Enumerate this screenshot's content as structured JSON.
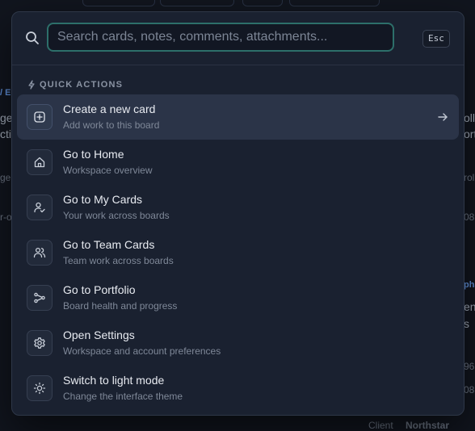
{
  "background": {
    "fragments": [
      "ge",
      "cti",
      "gel",
      "r-o",
      "olli",
      "ort",
      "rol",
      "08",
      "pha",
      "end",
      "s",
      "96",
      "08",
      "Client",
      "Northstar",
      "/ E"
    ]
  },
  "search": {
    "placeholder": "Search cards, notes, comments, attachments...",
    "value": "",
    "esc_label": "Esc",
    "icon": "search-icon"
  },
  "section": {
    "title": "QUICK ACTIONS",
    "icon": "bolt-icon"
  },
  "items": [
    {
      "title": "Create a new card",
      "subtitle": "Add work to this board",
      "icon": "plus-square-icon",
      "selected": true
    },
    {
      "title": "Go to Home",
      "subtitle": "Workspace overview",
      "icon": "home-icon"
    },
    {
      "title": "Go to My Cards",
      "subtitle": "Your work across boards",
      "icon": "user-check-icon"
    },
    {
      "title": "Go to Team Cards",
      "subtitle": "Team work across boards",
      "icon": "users-icon"
    },
    {
      "title": "Go to Portfolio",
      "subtitle": "Board health and progress",
      "icon": "branch-icon"
    },
    {
      "title": "Open Settings",
      "subtitle": "Workspace and account preferences",
      "icon": "gear-icon"
    },
    {
      "title": "Switch to light mode",
      "subtitle": "Change the interface theme",
      "icon": "sun-icon"
    }
  ],
  "colors": {
    "accent": "#2d6f6a",
    "panel": "#1a2130",
    "selected_row": "#2b3448",
    "backdrop": "#11151e"
  }
}
